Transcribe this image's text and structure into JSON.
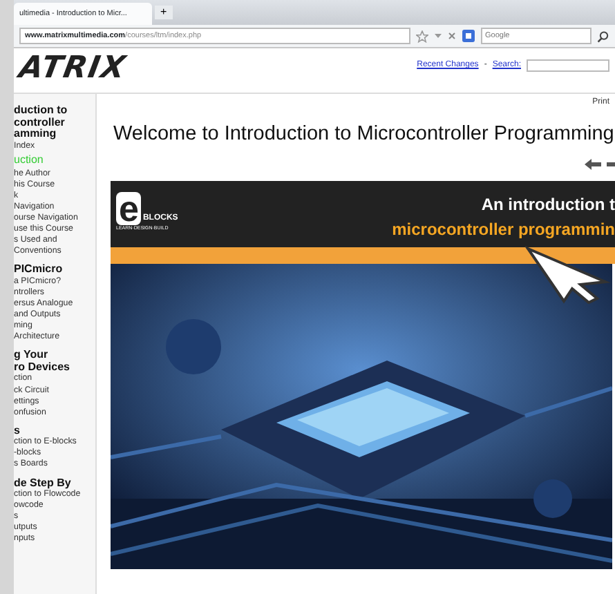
{
  "browser": {
    "tab": {
      "title": "ultimedia - Introduction to Micr..."
    },
    "new_tab": "+",
    "url": {
      "domain": "www.matrixmultimedia.com",
      "path": "/courses/ltm/index.php"
    },
    "search": {
      "placeholder": "Google"
    }
  },
  "header": {
    "logo": "ATRIX",
    "links": [
      "Recent Changes",
      "Search:"
    ],
    "separator": "-"
  },
  "sidebar": [
    {
      "kind": "heading",
      "lines": [
        "duction to",
        "controller",
        "amming"
      ]
    },
    {
      "kind": "link",
      "text": "Index"
    },
    {
      "kind": "active",
      "text": "uction"
    },
    {
      "kind": "link",
      "text": "he Author"
    },
    {
      "kind": "link",
      "text": "his Course"
    },
    {
      "kind": "link",
      "text": "k"
    },
    {
      "kind": "link",
      "text": "Navigation"
    },
    {
      "kind": "link",
      "text": "ourse Navigation"
    },
    {
      "kind": "link",
      "text": "use this Course"
    },
    {
      "kind": "link",
      "text": "s Used and"
    },
    {
      "kind": "link",
      "text": "Conventions"
    },
    {
      "kind": "heading",
      "lines": [
        "PICmicro"
      ]
    },
    {
      "kind": "link",
      "text": "a PICmicro?"
    },
    {
      "kind": "link",
      "text": "ntrollers"
    },
    {
      "kind": "link",
      "text": "ersus Analogue"
    },
    {
      "kind": "link",
      "text": "and Outputs"
    },
    {
      "kind": "link",
      "text": "ming"
    },
    {
      "kind": "link",
      "text": "Architecture"
    },
    {
      "kind": "heading",
      "lines": [
        "g Your",
        "ro Devices"
      ]
    },
    {
      "kind": "link",
      "text": "ction"
    },
    {
      "kind": "link",
      "text": "ck Circuit"
    },
    {
      "kind": "link",
      "text": "ettings"
    },
    {
      "kind": "link",
      "text": "onfusion"
    },
    {
      "kind": "heading",
      "lines": [
        "s"
      ]
    },
    {
      "kind": "link",
      "text": "ction to E-blocks"
    },
    {
      "kind": "link",
      "text": "-blocks"
    },
    {
      "kind": "link",
      "text": "s Boards"
    },
    {
      "kind": "heading",
      "lines": [
        "de Step By"
      ]
    },
    {
      "kind": "link",
      "text": "ction to Flowcode"
    },
    {
      "kind": "link",
      "text": "owcode"
    },
    {
      "kind": "link",
      "text": "s"
    },
    {
      "kind": "link",
      "text": "utputs"
    },
    {
      "kind": "link",
      "text": "nputs"
    }
  ],
  "content": {
    "print": "Print",
    "title": "Welcome to Introduction to Microcontroller Programming",
    "banner": {
      "logo_letter": "e",
      "logo_word": "BLOCKS",
      "logo_tagline": "LEARN·DESIGN·BUILD",
      "line_1": "An introduction t",
      "line_2": "microcontroller programmin"
    }
  }
}
